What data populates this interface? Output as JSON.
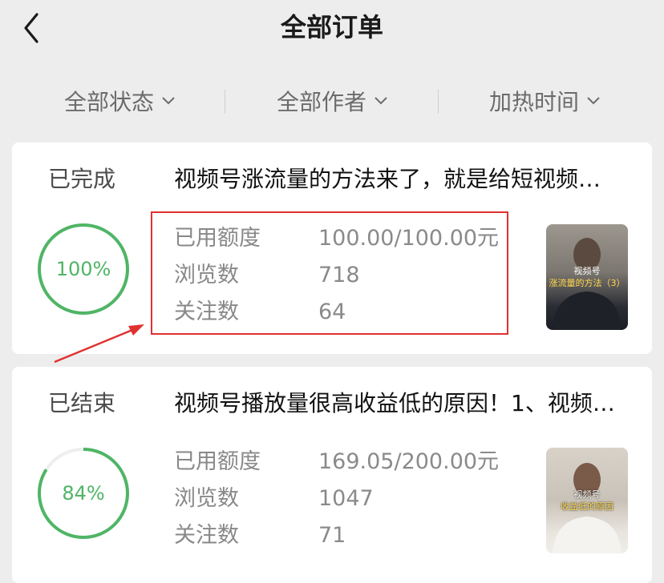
{
  "header": {
    "title": "全部订单"
  },
  "filters": [
    {
      "label": "全部状态"
    },
    {
      "label": "全部作者"
    },
    {
      "label": "加热时间"
    }
  ],
  "orders": [
    {
      "status": "已完成",
      "title": "视频号涨流量的方法来了，就是给短视频…",
      "progress_text": "100%",
      "progress": 1.0,
      "stats": [
        {
          "label": "已用额度",
          "value": "100.00/100.00元"
        },
        {
          "label": "浏览数",
          "value": "718"
        },
        {
          "label": "关注数",
          "value": "64"
        }
      ],
      "thumb": {
        "line1": "视频号",
        "line2": "涨流量的方法（3）"
      }
    },
    {
      "status": "已结束",
      "title": "视频号播放量很高收益低的原因！1、视频…",
      "progress_text": "84%",
      "progress": 0.84,
      "stats": [
        {
          "label": "已用额度",
          "value": "169.05/200.00元"
        },
        {
          "label": "浏览数",
          "value": "1047"
        },
        {
          "label": "关注数",
          "value": "71"
        }
      ],
      "thumb": {
        "line1": "视频号",
        "line2": "收益低的原因"
      }
    }
  ],
  "colors": {
    "accent_green": "#4fb565",
    "annotation_red": "#e03131",
    "background": "#ededed"
  }
}
